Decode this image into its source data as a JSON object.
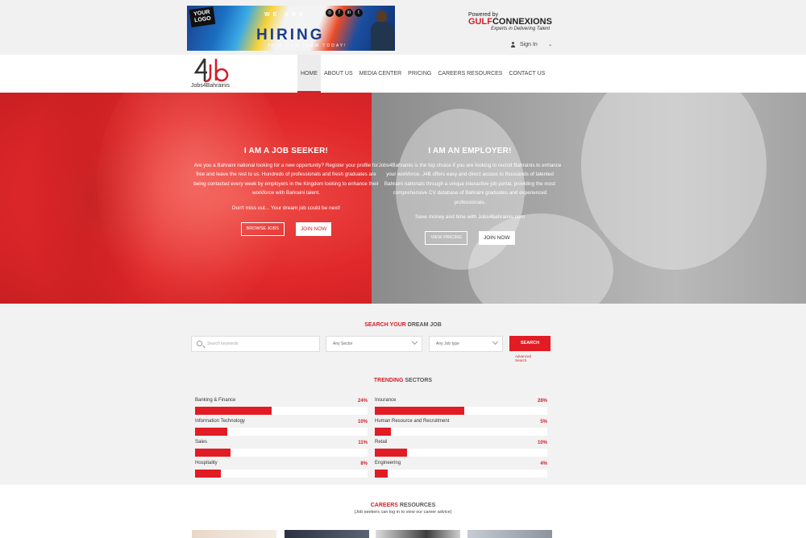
{
  "banner": {
    "logo_text": "YOUR LOGO",
    "we_are": "WE ARE",
    "hiring": "HIRING",
    "subline": "JOIN OUR TEAM TODAY!",
    "social_icons": [
      "instagram-icon",
      "facebook-icon",
      "linkedin-icon",
      "twitter-icon"
    ]
  },
  "partner": {
    "powered_by": "Powered by",
    "name_a": "GULF",
    "name_b": "CONNEXIONS",
    "tagline": "Experts in Delivering Talent"
  },
  "account": {
    "signin_label": "Sign In"
  },
  "brand": {
    "name": "Jobs4Bahrainis"
  },
  "nav": {
    "items": [
      {
        "label": "HOME"
      },
      {
        "label": "ABOUT US"
      },
      {
        "label": "MEDIA CENTER"
      },
      {
        "label": "PRICING"
      },
      {
        "label": "CAREERS RESOURCES"
      },
      {
        "label": "CONTACT US"
      }
    ]
  },
  "hero": {
    "seeker": {
      "title": "I AM A JOB SEEKER!",
      "body": "Are you a Bahraini national looking for a new opportunity? Register your profile for free and leave the rest to us. Hundreds of professionals and fresh graduates are being contacted every week by employers in the Kingdom looking to enhance their workforce with Bahraini talent.",
      "tagline": "Don't miss out... Your dream job could be next!",
      "btn_primary": "BROWSE JOBS",
      "btn_secondary": "JOIN NOW"
    },
    "employer": {
      "title": "I AM AN EMPLOYER!",
      "body": "Jobs4Bahrainis is the top choice if you are looking to recruit Bahrainis to enhance your workforce. J4B offers easy and direct access to thousands of talented Bahraini nationals through a unique interactive job portal, providing the most comprehensive CV database of Bahraini graduates and experienced professionals.",
      "tagline": "Save money and time with Jobs4bahrainis.com",
      "btn_primary": "VIEW PRICING",
      "btn_secondary": "JOIN NOW"
    }
  },
  "search": {
    "title_red": "SEARCH YOUR",
    "title_rest": "DREAM JOB",
    "keywords_placeholder": "Search keywords",
    "sector_value": "Any Sector",
    "jobtype_value": "Any Job type",
    "button": "SEARCH",
    "advanced": "Advanced Search"
  },
  "trending": {
    "title_red": "TRENDING",
    "title_rest": "SECTORS",
    "sectors": [
      {
        "name": "Banking & Finance",
        "percent": 24,
        "label": "24%"
      },
      {
        "name": "Insurance",
        "percent": 28,
        "label": "28%"
      },
      {
        "name": "Information Technology",
        "percent": 10,
        "label": "10%"
      },
      {
        "name": "Human Resource and Recruitment",
        "percent": 5,
        "label": "5%"
      },
      {
        "name": "Sales",
        "percent": 11,
        "label": "11%"
      },
      {
        "name": "Retail",
        "percent": 10,
        "label": "10%"
      },
      {
        "name": "Hospitality",
        "percent": 8,
        "label": "8%"
      },
      {
        "name": "Engineering",
        "percent": 4,
        "label": "4%"
      }
    ]
  },
  "careers": {
    "title_red": "CAREERS",
    "title_rest": "RESOURCES",
    "subtitle": "(Job seekers can log in to view our career advice)"
  },
  "colors": {
    "accent": "#e11c24",
    "hero_left": "#e0282a",
    "hero_right": "#a6a6a6"
  }
}
